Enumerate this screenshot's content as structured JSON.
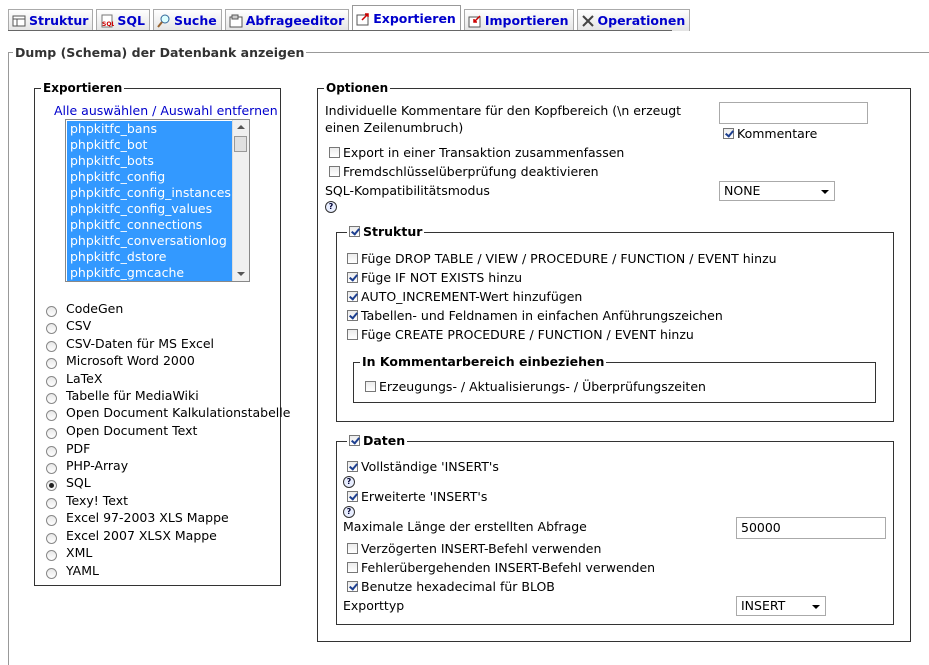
{
  "tabs": [
    {
      "label": "Struktur",
      "icon": "structure-icon"
    },
    {
      "label": "SQL",
      "icon": "sql-icon"
    },
    {
      "label": "Suche",
      "icon": "search-icon"
    },
    {
      "label": "Abfrageeditor",
      "icon": "query-icon"
    },
    {
      "label": "Exportieren",
      "icon": "export-icon"
    },
    {
      "label": "Importieren",
      "icon": "import-icon"
    },
    {
      "label": "Operationen",
      "icon": "tools-icon"
    }
  ],
  "page_title": "Dump (Schema) der Datenbank anzeigen",
  "export": {
    "legend": "Exportieren",
    "select_all": "Alle auswählen",
    "separator": "/",
    "deselect": "Auswahl entfernen",
    "tables": [
      "phpkitfc_bans",
      "phpkitfc_bot",
      "phpkitfc_bots",
      "phpkitfc_config",
      "phpkitfc_config_instances",
      "phpkitfc_config_values",
      "phpkitfc_connections",
      "phpkitfc_conversationlog",
      "phpkitfc_dstore",
      "phpkitfc_gmcache"
    ],
    "formats": [
      "CodeGen",
      "CSV",
      "CSV-Daten für MS Excel",
      "Microsoft Word 2000",
      "LaTeX",
      "Tabelle für MediaWiki",
      "Open Document Kalkulationstabelle",
      "Open Document Text",
      "PDF",
      "PHP-Array",
      "SQL",
      "Texy! Text",
      "Excel 97-2003 XLS Mappe",
      "Excel 2007 XLSX Mappe",
      "XML",
      "YAML"
    ],
    "selected_format": "SQL"
  },
  "options": {
    "legend": "Optionen",
    "header_comment_label": "Individuelle Kommentare für den Kopfbereich (\\n erzeugt einen Zeilenumbruch)",
    "header_comment_value": "",
    "comments_label": "Kommentare",
    "transaction_label": "Export in einer Transaktion zusammenfassen",
    "fk_label": "Fremdschlüsselüberprüfung deaktivieren",
    "compat_label": "SQL-Kompatibilitätsmodus",
    "compat_value": "NONE",
    "help_glyph": "?",
    "structure": {
      "legend": "Struktur",
      "items": [
        {
          "label": "Füge DROP TABLE / VIEW / PROCEDURE / FUNCTION / EVENT hinzu",
          "checked": false
        },
        {
          "label": "Füge IF NOT EXISTS hinzu",
          "checked": true
        },
        {
          "label": "AUTO_INCREMENT-Wert hinzufügen",
          "checked": true
        },
        {
          "label": "Tabellen- und Feldnamen in einfachen Anführungszeichen",
          "checked": true
        },
        {
          "label": "Füge CREATE PROCEDURE / FUNCTION / EVENT hinzu",
          "checked": false
        }
      ],
      "comments_legend": "In Kommentarbereich einbeziehen",
      "timestamps_label": "Erzeugungs- / Aktualisierungs- / Überprüfungszeiten"
    },
    "data": {
      "legend": "Daten",
      "complete_inserts": "Vollständige 'INSERT's",
      "extended_inserts": "Erweiterte 'INSERT's",
      "max_len_label": "Maximale Länge der erstellten Abfrage",
      "max_len_value": "50000",
      "delayed": "Verzögerten INSERT-Befehl verwenden",
      "ignore": "Fehlerübergehenden INSERT-Befehl verwenden",
      "hex": "Benutze hexadecimal für BLOB",
      "export_type_label": "Exporttyp",
      "export_type_value": "INSERT"
    }
  }
}
